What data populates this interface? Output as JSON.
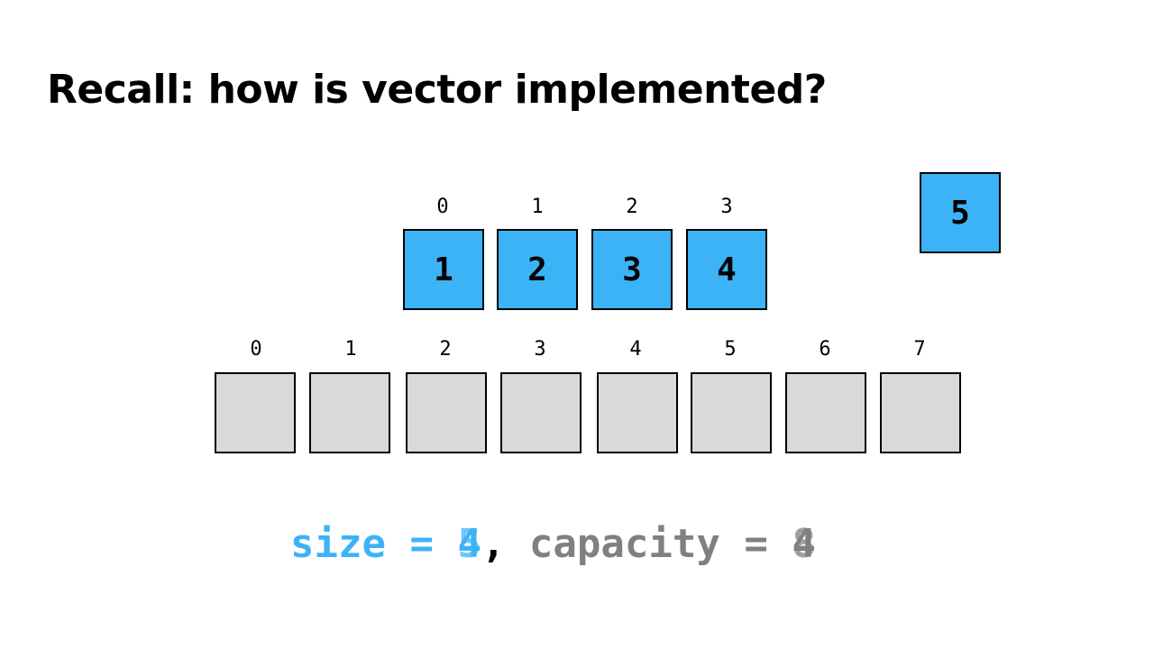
{
  "title": "Recall: how is vector implemented?",
  "colors": {
    "element": "#3db3f7",
    "empty": "#d9d9d9",
    "size_text": "#3db3f7",
    "capacity_text": "#808080"
  },
  "old_array": {
    "indices": [
      "0",
      "1",
      "2",
      "3"
    ],
    "values": [
      "1",
      "2",
      "3",
      "4"
    ]
  },
  "new_element": "5",
  "new_array": {
    "indices": [
      "0",
      "1",
      "2",
      "3",
      "4",
      "5",
      "6",
      "7"
    ]
  },
  "status": {
    "size_label": "size = ",
    "size_values": [
      "4",
      "5"
    ],
    "separator": ",",
    "capacity_label": " capacity = ",
    "capacity_values": [
      "4",
      "8"
    ]
  }
}
